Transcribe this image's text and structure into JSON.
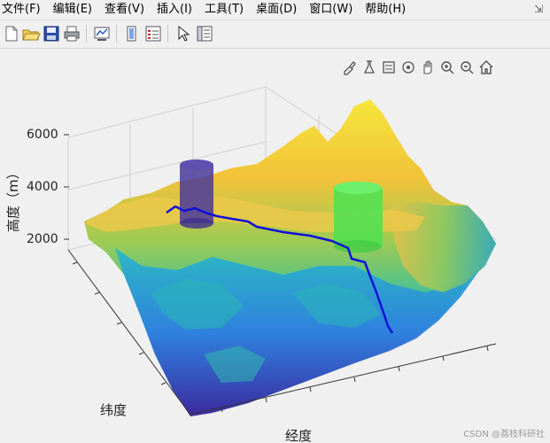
{
  "menu": [
    {
      "label": "文件(F)",
      "name": "menu-file"
    },
    {
      "label": "编辑(E)",
      "name": "menu-edit"
    },
    {
      "label": "查看(V)",
      "name": "menu-view"
    },
    {
      "label": "插入(I)",
      "name": "menu-insert"
    },
    {
      "label": "工具(T)",
      "name": "menu-tools"
    },
    {
      "label": "桌面(D)",
      "name": "menu-desktop"
    },
    {
      "label": "窗口(W)",
      "name": "menu-window"
    },
    {
      "label": "帮助(H)",
      "name": "menu-help"
    }
  ],
  "toolbar": [
    "new-file-icon",
    "open-folder-icon",
    "save-icon",
    "print-icon",
    "link-plot-icon",
    "insert-colorbar-icon",
    "insert-legend-icon",
    "pointer-icon",
    "property-inspector-icon"
  ],
  "axes_toolbar": [
    "brush-icon",
    "data-tips-icon",
    "pan-icon",
    "rotate-icon",
    "hand-icon",
    "zoom-in-icon",
    "zoom-out-icon",
    "home-icon"
  ],
  "chart_data": {
    "type": "surface",
    "title": "",
    "xlabel": "经度",
    "ylabel": "纬度",
    "zlabel": "高度（m）",
    "z_ticks": [
      "2000",
      "4000",
      "6000"
    ],
    "z_range": [
      2000,
      6000
    ],
    "colormap": [
      "#3b2a9e",
      "#2f6fe0",
      "#1fa5c8",
      "#3fc08a",
      "#b7c74a",
      "#f2c23a",
      "#f5e63a"
    ],
    "path_color": "#1010d8",
    "obstacles": [
      {
        "name": "cylinder-1",
        "color": "#4a3a9a"
      },
      {
        "name": "cylinder-2",
        "color": "#52e052"
      }
    ]
  },
  "watermark": "CSDN @荔枝科研社"
}
